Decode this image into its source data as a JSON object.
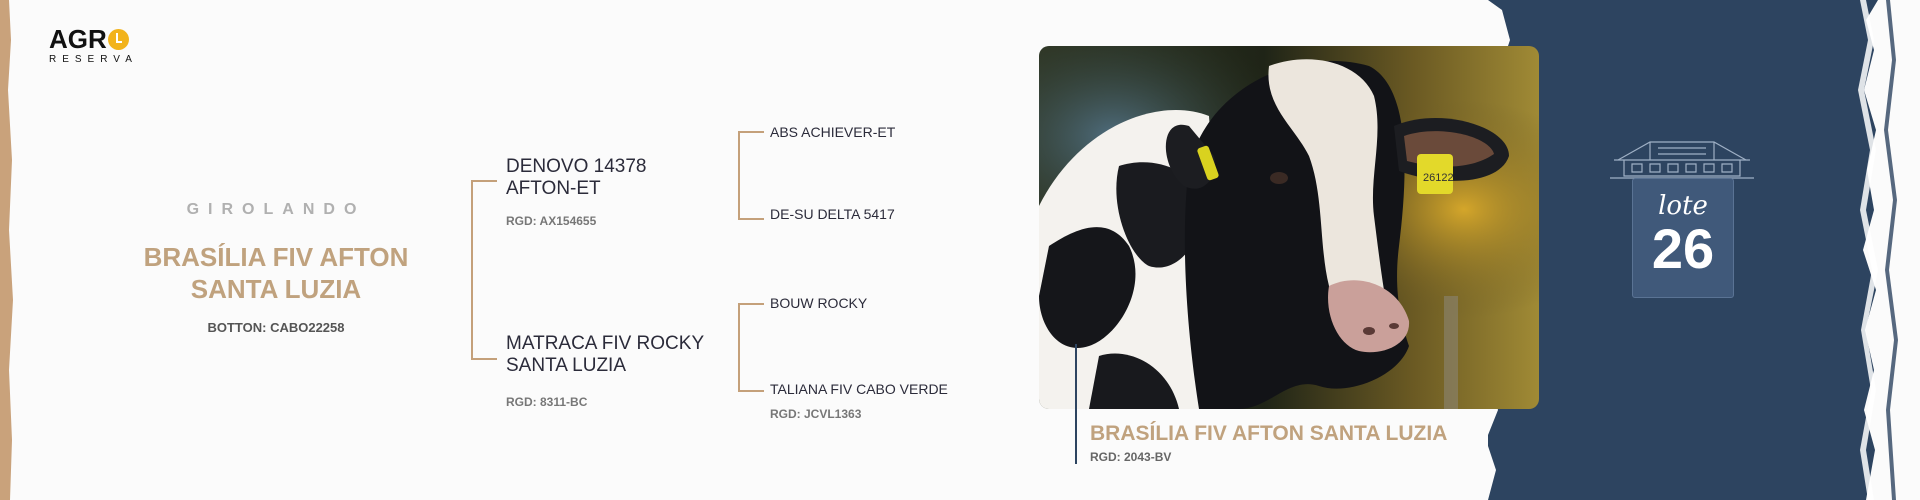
{
  "brand": {
    "logo_main": "AGR",
    "logo_sub": "RESERVA",
    "accent": "#f2b31c"
  },
  "animal": {
    "breed": "GIROLANDO",
    "name_line1": "BRASÍLIA FIV AFTON",
    "name_line2": "SANTA LUZIA",
    "botton": "BOTTON: CABO22258"
  },
  "pedigree": {
    "sire": {
      "name_line1": "DENOVO 14378",
      "name_line2": "AFTON-ET",
      "rgd": "RGD: AX154655"
    },
    "dam": {
      "name_line1": "MATRACA FIV ROCKY",
      "name_line2": "SANTA LUZIA",
      "rgd": "RGD: 8311-BC"
    },
    "sire_sire": "ABS ACHIEVER-ET",
    "sire_dam": "DE-SU DELTA 5417",
    "dam_sire": "BOUW ROCKY",
    "dam_dam": "TALIANA FIV CABO VERDE",
    "dam_dam_rgd": "RGD: JCVL1363"
  },
  "photo": {
    "ear_tag": "26122"
  },
  "caption": {
    "name": "BRASÍLIA FIV AFTON SANTA LUZIA",
    "rgd": "RGD: 2043-BV"
  },
  "lot": {
    "label": "lote",
    "number": "26"
  },
  "colors": {
    "gold": "#c0a27e",
    "navy": "#2d4460",
    "line": "#c4a07a"
  }
}
